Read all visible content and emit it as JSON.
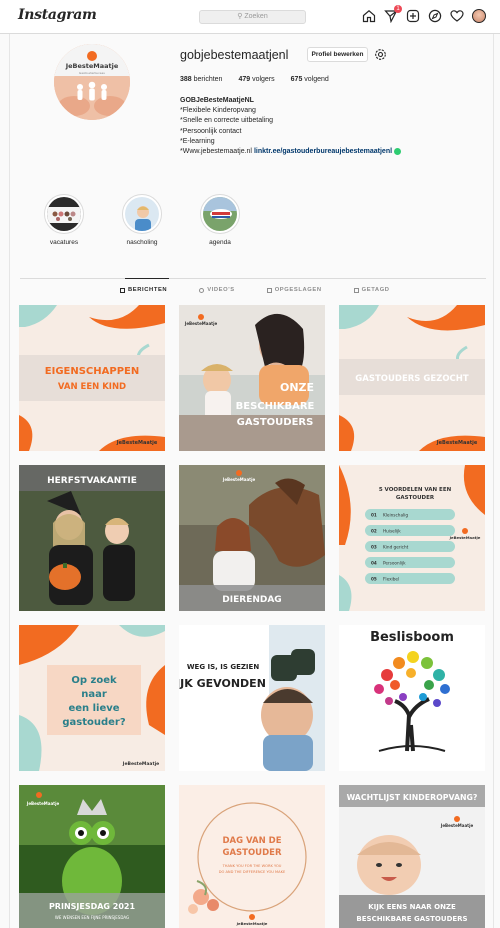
{
  "nav": {
    "logo": "Instagram",
    "search_placeholder": "Zoeken",
    "notification_count": "1",
    "icons": [
      "home-icon",
      "direct-icon",
      "new-post-icon",
      "explore-icon",
      "heart-icon",
      "avatar"
    ]
  },
  "profile": {
    "username": "gobjebestemaatjenl",
    "edit_label": "Profiel bewerken",
    "avatar_text": "JeBesteMaatje",
    "avatar_sub": "Gastouderbureau",
    "stats": {
      "posts_num": "388",
      "posts_label": "berichten",
      "followers_num": "479",
      "followers_label": "volgers",
      "following_num": "675",
      "following_label": "volgend"
    },
    "bio": {
      "name": "GOBJeBesteMaatjeNL",
      "lines": [
        "*Flexibele Kinderopvang",
        "*Snelle en correcte uitbetaling",
        "*Persoonlijk contact",
        "*E-learning"
      ],
      "web_prefix": "*Www.jebestemaatje.nl",
      "link": "linktr.ee/gastouderbureaujebestemaatjenl"
    }
  },
  "highlights": [
    {
      "label": "vacatures"
    },
    {
      "label": "nascholing"
    },
    {
      "label": "agenda"
    }
  ],
  "tabs": [
    {
      "label": "BERICHTEN",
      "active": true
    },
    {
      "label": "VIDEO'S",
      "active": false
    },
    {
      "label": "OPGESLAGEN",
      "active": false
    },
    {
      "label": "GETAGD",
      "active": false
    }
  ],
  "posts": {
    "p1": {
      "line1": "EIGENSCHAPPEN",
      "line2": "VAN EEN KIND",
      "brand": "JeBesteMaatje"
    },
    "p2": {
      "line1": "ONZE",
      "line2": "BESCHIKBARE",
      "line3": "GASTOUDERS",
      "brand": "JeBesteMaatje"
    },
    "p3": {
      "line1": "GASTOUDERS GEZOCHT",
      "brand": "JeBesteMaatje"
    },
    "p4": {
      "line1": "HERFSTVAKANTIE"
    },
    "p5": {
      "line1": "DIERENDAG",
      "brand": "JeBesteMaatje"
    },
    "p6": {
      "title1": "5 VOORDELEN VAN EEN",
      "title2": "GASTOUDER",
      "items": [
        "Kleinschalig",
        "Huiselijk",
        "Kind gericht",
        "Persoonlijk",
        "Flexibel"
      ],
      "nums": [
        "01",
        "02",
        "03",
        "04",
        "05"
      ],
      "brand": "JeBesteMaatje"
    },
    "p7": {
      "line1": "Op zoek",
      "line2": "naar",
      "line3": "een lieve",
      "line4": "gastouder?",
      "brand": "JeBesteMaatje"
    },
    "p8": {
      "line1": "WEG IS, IS GEZIEN",
      "line2": "IJK GEVONDEN"
    },
    "p9": {
      "line1": "Beslisboom"
    },
    "p10": {
      "line1": "PRINSJESDAG 2021",
      "line2": "WE WENSEN EEN FIJNE PRINSJESDAG",
      "brand": "JeBesteMaatje"
    },
    "p11": {
      "line1": "DAG VAN DE",
      "line2": "GASTOUDER",
      "line3": "THANK YOU FOR THE WORK YOU",
      "line4": "DO AND THE DIFFERENCE YOU MAKE",
      "brand": "JeBesteMaatje"
    },
    "p12": {
      "line1": "WACHTLIJST KINDEROPVANG?",
      "line2": "KIJK EENS NAAR ONZE",
      "line3": "BESCHIKBARE GASTOUDERS",
      "brand": "JeBesteMaatje"
    }
  },
  "colors": {
    "accent_orange": "#f26b21",
    "mint": "#a8d8d0",
    "peach": "#f7e3d8",
    "link_blue": "#00376b"
  }
}
